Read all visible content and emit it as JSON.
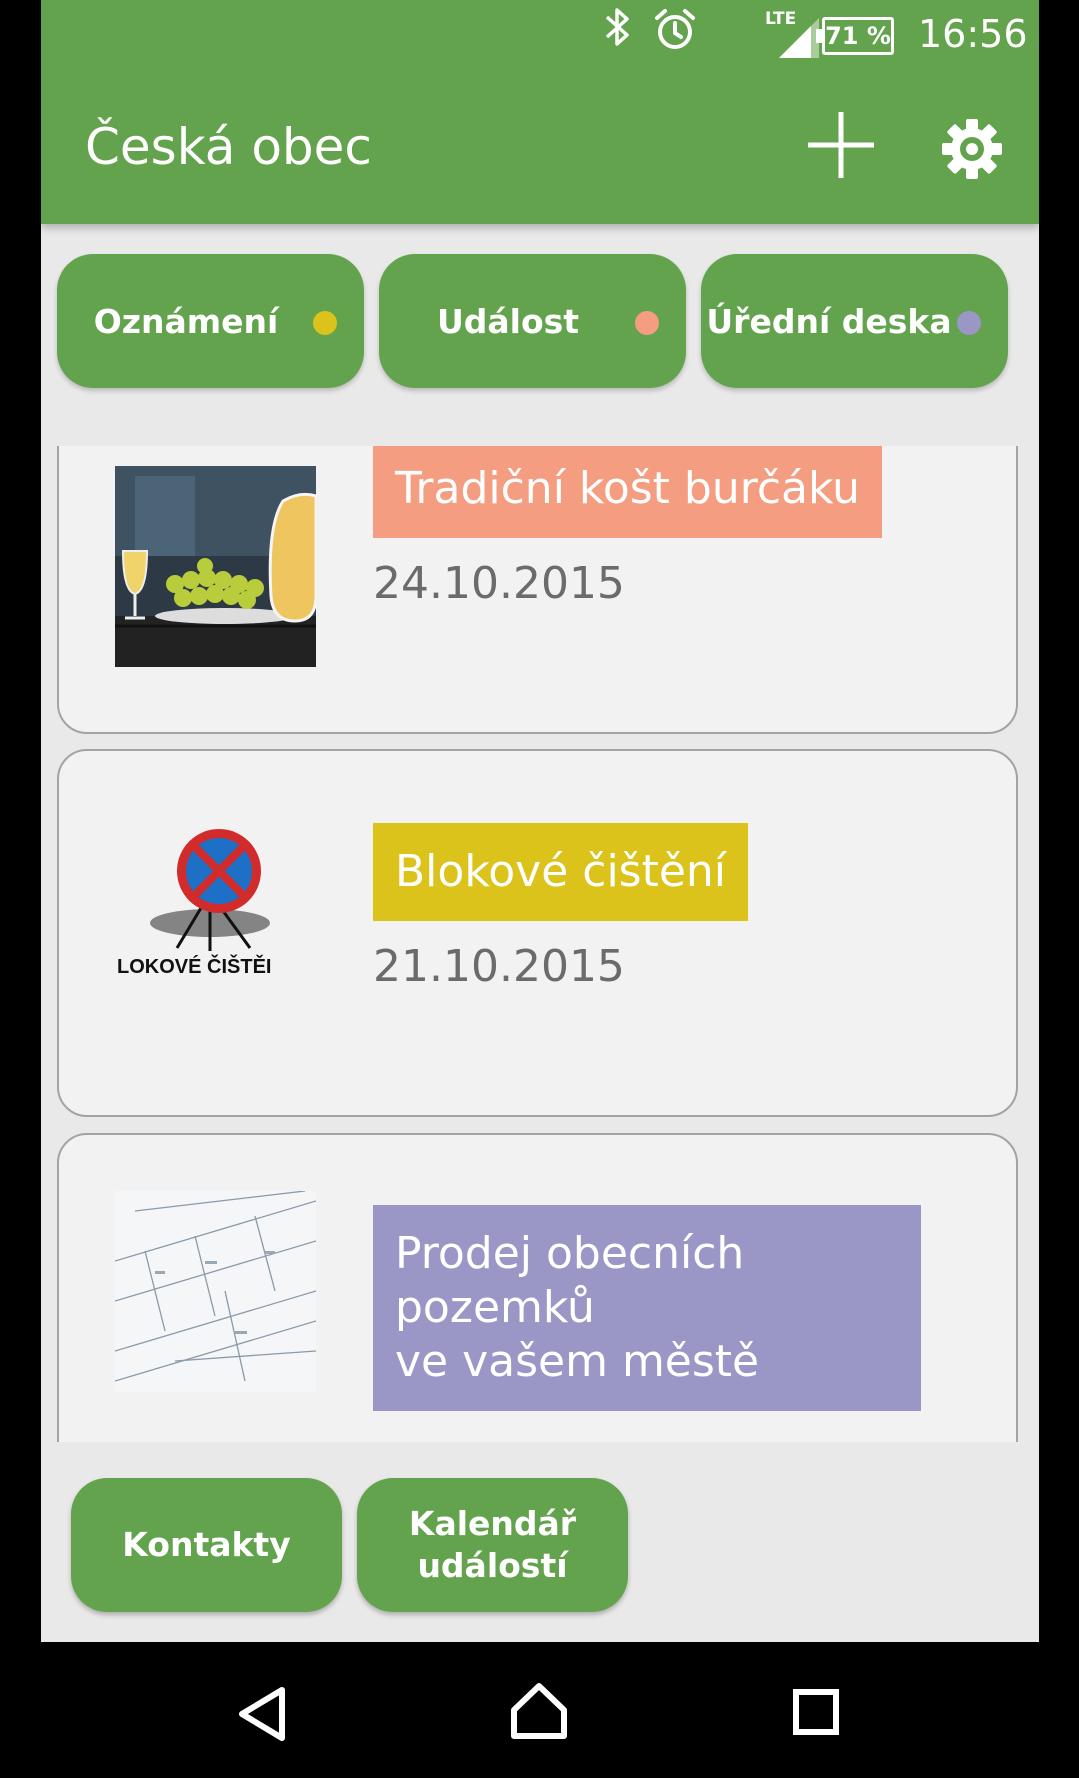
{
  "status_bar": {
    "bluetooth_icon": "bluetooth-icon",
    "alarm_icon": "alarm-icon",
    "network": "LTE",
    "battery": "71 %",
    "time": "16:56"
  },
  "app_bar": {
    "title": "Česká obec",
    "add_icon": "plus-icon",
    "settings_icon": "gear-icon"
  },
  "filters": [
    {
      "label": "Oznámení",
      "dot_color": "#dbc31b"
    },
    {
      "label": "Událost",
      "dot_color": "#f49d80"
    },
    {
      "label": "Úřední deska",
      "dot_color": "#9a97c6"
    }
  ],
  "items": [
    {
      "title": "Tradiční košt burčáku",
      "date": "24.10.2015",
      "color": "#f49d80",
      "image": "grapes-and-wine-photo"
    },
    {
      "title": "Blokové čištění",
      "date": "21.10.2015",
      "color": "#dbc31b",
      "image": "no-parking-sign",
      "image_caption": "LOKOVÉ ČIŠTĚI"
    },
    {
      "title_line1": "Prodej obecních pozemků",
      "title_line2": "ve vašem městě",
      "color": "#9a97c6",
      "image": "land-plot-map"
    }
  ],
  "bottom_buttons": [
    {
      "label": "Kontakty"
    },
    {
      "label_line1": "Kalendář",
      "label_line2": "událostí"
    }
  ],
  "colors": {
    "primary": "#64a34d",
    "background": "#e9e9e9",
    "card": "#f2f2f2"
  }
}
